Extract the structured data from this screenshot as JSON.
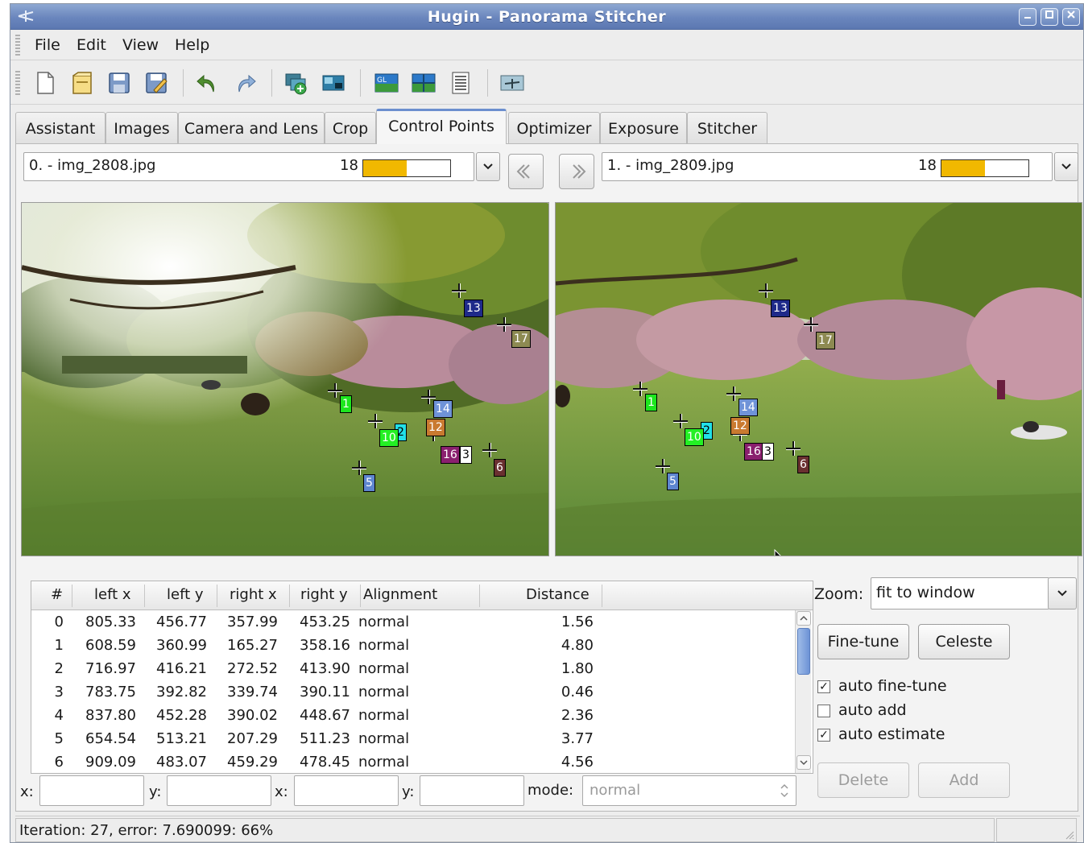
{
  "window": {
    "title": "Hugin - Panorama Stitcher"
  },
  "menu": [
    "File",
    "Edit",
    "View",
    "Help"
  ],
  "toolbar": {
    "icons": [
      "new-project-icon",
      "open-project-icon",
      "save-icon",
      "save-as-icon",
      "undo-icon",
      "redo-icon",
      "add-images-icon",
      "add-time-series-icon",
      "gl-preview-icon",
      "preview-icon",
      "batch-list-icon",
      "assistant-icon"
    ]
  },
  "tabs": [
    "Assistant",
    "Images",
    "Camera and Lens",
    "Crop",
    "Control Points",
    "Optimizer",
    "Exposure",
    "Stitcher"
  ],
  "active_tab": "Control Points",
  "left_image": {
    "label": "0. - img_2808.jpg",
    "count": "18",
    "progress": 0.5
  },
  "right_image": {
    "label": "1. - img_2809.jpg",
    "count": "18",
    "progress": 0.5
  },
  "points_left": [
    "13",
    "17",
    "1",
    "14",
    "12",
    "2",
    "10",
    "16",
    "3",
    "6",
    "5"
  ],
  "points_right": [
    "13",
    "17",
    "1",
    "14",
    "12",
    "2",
    "10",
    "16",
    "3",
    "6",
    "5"
  ],
  "table": {
    "headers": [
      "#",
      "left x",
      "left y",
      "right x",
      "right y",
      "Alignment",
      "Distance"
    ],
    "rows": [
      [
        "0",
        "805.33",
        "456.77",
        "357.99",
        "453.25",
        "normal",
        "1.56"
      ],
      [
        "1",
        "608.59",
        "360.99",
        "165.27",
        "358.16",
        "normal",
        "4.80"
      ],
      [
        "2",
        "716.97",
        "416.21",
        "272.52",
        "413.90",
        "normal",
        "1.80"
      ],
      [
        "3",
        "783.75",
        "392.82",
        "339.74",
        "390.11",
        "normal",
        "0.46"
      ],
      [
        "4",
        "837.80",
        "452.28",
        "390.02",
        "448.67",
        "normal",
        "2.36"
      ],
      [
        "5",
        "654.54",
        "513.21",
        "207.29",
        "511.23",
        "normal",
        "3.77"
      ],
      [
        "6",
        "909.09",
        "483.07",
        "459.29",
        "478.45",
        "normal",
        "4.56"
      ]
    ]
  },
  "coords": {
    "x1_label": "x:",
    "y1_label": "y:",
    "x2_label": "x:",
    "y2_label": "y:",
    "mode_label": "mode:",
    "mode_value": "normal"
  },
  "right_panel": {
    "zoom_label": "Zoom:",
    "zoom_value": "fit to window",
    "fine_tune": "Fine-tune",
    "celeste": "Celeste",
    "auto_fine_tune": "auto fine-tune",
    "auto_fine_tune_checked": true,
    "auto_add": "auto add",
    "auto_add_checked": false,
    "auto_estimate": "auto estimate",
    "auto_estimate_checked": true,
    "delete": "Delete",
    "add": "Add"
  },
  "status": {
    "text": "Iteration: 27, error: 7.690099: 66%"
  },
  "colors": {
    "accent": "#6c8fcf",
    "progress_fill": "#f1b800",
    "titlebar": "#6a86bd"
  }
}
